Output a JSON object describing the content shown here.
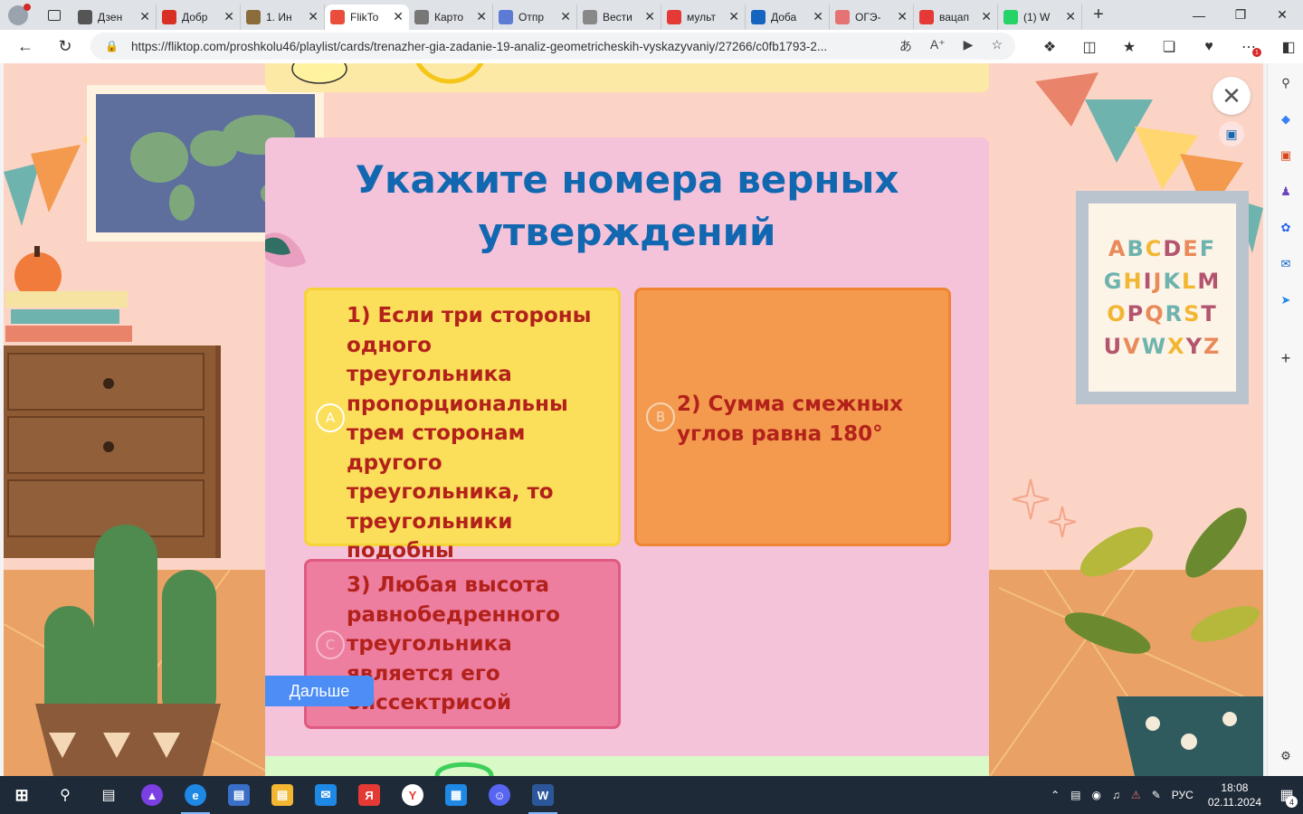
{
  "browser": {
    "tabs": [
      {
        "label": "Дзен",
        "icon": "plus-square-icon",
        "color": "#555555"
      },
      {
        "label": "Добр",
        "icon": "gmail-icon",
        "color": "#d93025"
      },
      {
        "label": "1. Ин",
        "icon": "document-icon",
        "color": "#8a6d3b"
      },
      {
        "label": "FlikTo",
        "icon": "fliktop-icon",
        "color": "#e94e3c"
      },
      {
        "label": "Карто",
        "icon": "image-icon",
        "color": "#777777"
      },
      {
        "label": "Отпр",
        "icon": "mail-icon",
        "color": "#5b7bd5"
      },
      {
        "label": "Вести",
        "icon": "page-icon",
        "color": "#888888"
      },
      {
        "label": "мульт",
        "icon": "yandex-icon",
        "color": "#e53935"
      },
      {
        "label": "Доба",
        "icon": "book-icon",
        "color": "#1565c0"
      },
      {
        "label": "ОГЭ-",
        "icon": "record-icon",
        "color": "#e57373"
      },
      {
        "label": "вацап",
        "icon": "yandex-icon",
        "color": "#e53935"
      },
      {
        "label": "(1) W",
        "icon": "whatsapp-icon",
        "color": "#25d366"
      }
    ],
    "active_tab_index": 3,
    "new_tab": "+",
    "url": "https://fliktop.com/proshkolu46/playlist/cards/trenazher-gia-zadanie-19-analiz-geometricheskih-vyskazyvaniy/27266/c0fb1793-2...",
    "extension_badge": "1"
  },
  "quiz": {
    "title": "Укажите номера верных утверждений",
    "options": [
      {
        "letter": "A",
        "text": "1) Если три стороны одного треугольника пропорциональны трем сторонам другого треугольника, то треугольники подобны"
      },
      {
        "letter": "B",
        "text": "2) Сумма смежных углов равна 180°"
      },
      {
        "letter": "C",
        "text": "3) Любая высота равнобедренного треугольника является его биссектрисой"
      }
    ],
    "next_label": "Дальше"
  },
  "decor": {
    "alphabet_rows": [
      "ABCDEF",
      "GHIJKLM",
      "OPQRST",
      "UVWXYZ"
    ]
  },
  "taskbar": {
    "language": "РУС",
    "time": "18:08",
    "date": "02.11.2024",
    "notifications": "4"
  },
  "colors": {
    "title": "#1268b0",
    "option_a": "#fbde5a",
    "option_b": "#f39a4e",
    "option_c": "#ed7e9f",
    "option_text": "#b3211b",
    "next_button": "#4c8df6"
  }
}
